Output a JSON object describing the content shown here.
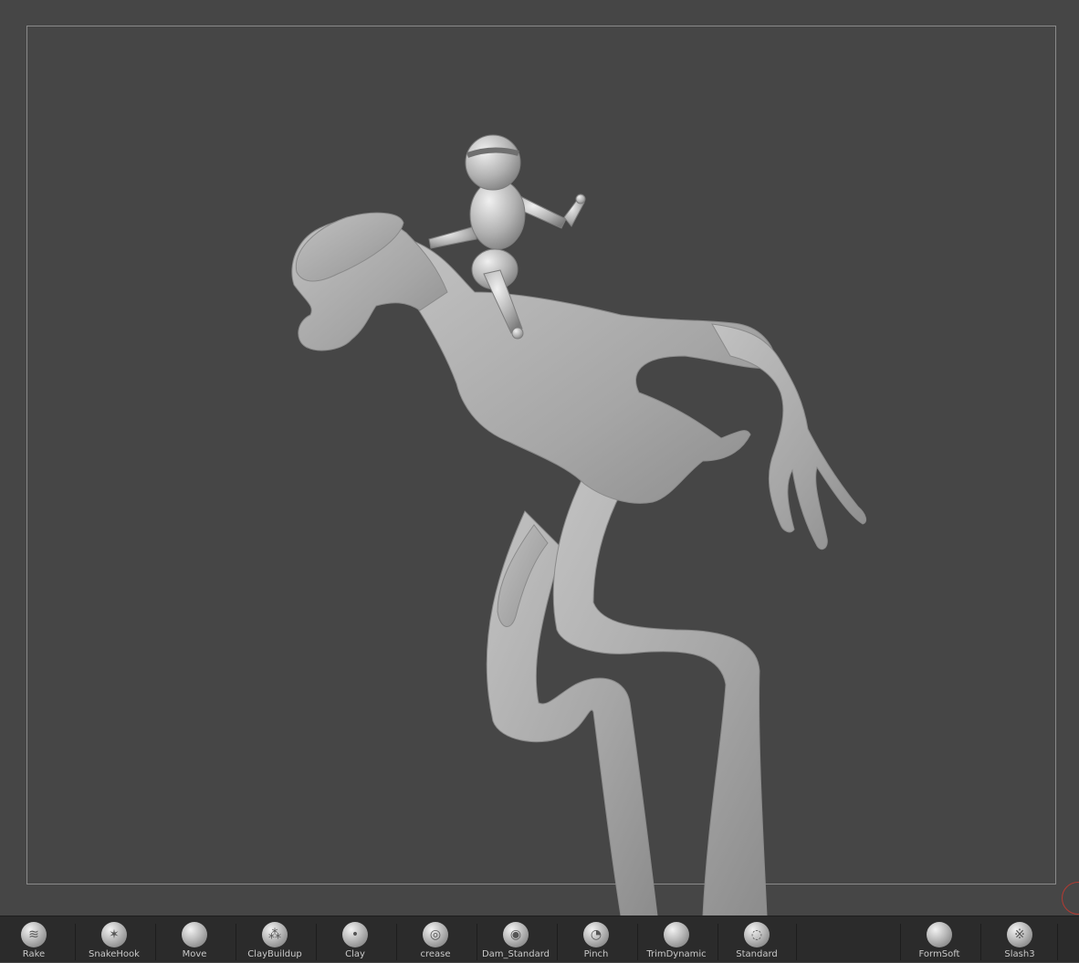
{
  "viewport": {
    "background": "#464646",
    "frame_color": "#8a8a8a",
    "model_color": "#a7a7a7"
  },
  "brushes": [
    {
      "label": "Rake",
      "icon": "rake-brush-icon",
      "glyph": "≋"
    },
    {
      "label": "SnakeHook",
      "icon": "snakehook-brush-icon",
      "glyph": "✶"
    },
    {
      "label": "Move",
      "icon": "move-brush-icon",
      "glyph": ""
    },
    {
      "label": "ClayBuildup",
      "icon": "claybuildup-brush-icon",
      "glyph": "⁂"
    },
    {
      "label": "Clay",
      "icon": "clay-brush-icon",
      "glyph": "•"
    },
    {
      "label": "crease",
      "icon": "crease-brush-icon",
      "glyph": "◎"
    },
    {
      "label": "Dam_Standard",
      "icon": "dam-standard-brush-icon",
      "glyph": "◉"
    },
    {
      "label": "Pinch",
      "icon": "pinch-brush-icon",
      "glyph": "◔"
    },
    {
      "label": "TrimDynamic",
      "icon": "trimdynamic-brush-icon",
      "glyph": ""
    },
    {
      "label": "Standard",
      "icon": "standard-brush-icon",
      "glyph": "◌"
    },
    {
      "label": "FormSoft",
      "icon": "formsoft-brush-icon",
      "glyph": ""
    },
    {
      "label": "Slash3",
      "icon": "slash3-brush-icon",
      "glyph": "※"
    }
  ]
}
